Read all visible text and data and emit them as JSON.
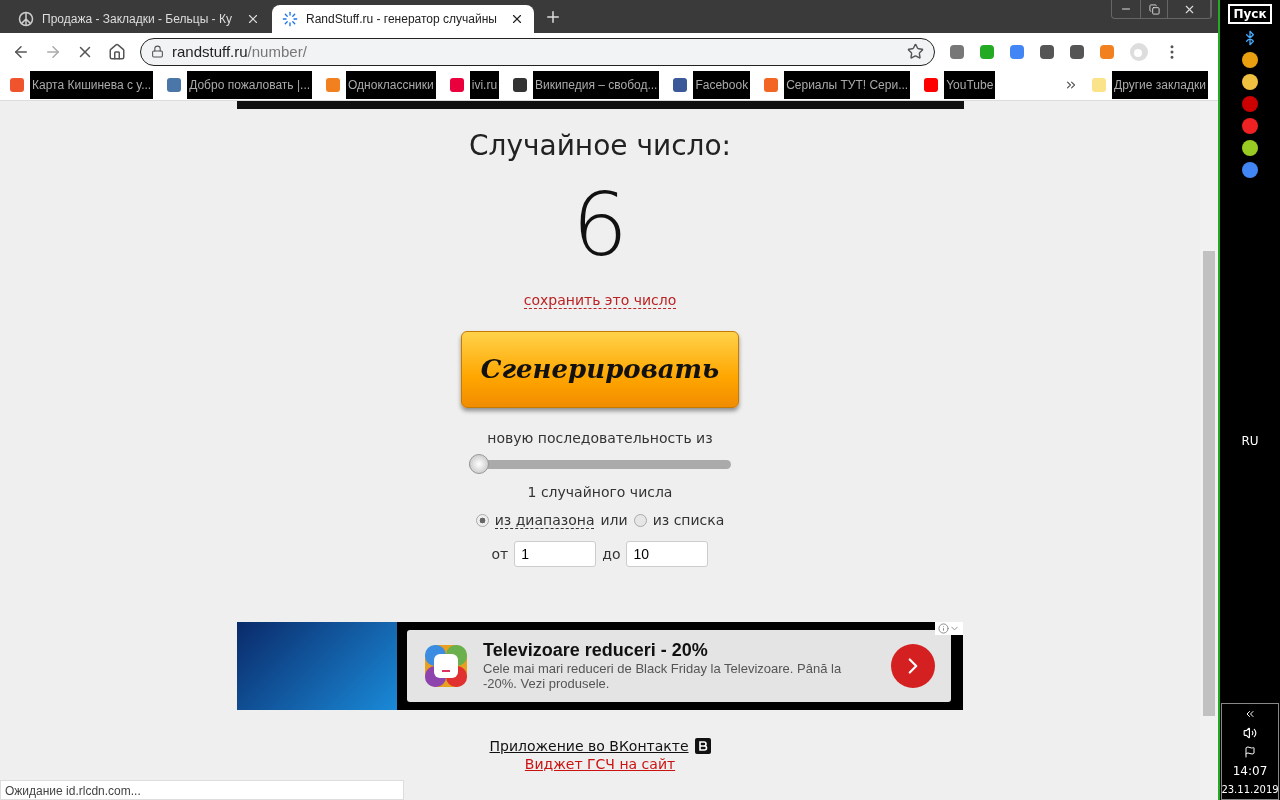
{
  "tabs": [
    {
      "title": "Продажа - Закладки - Бельцы - Ку",
      "selected": false,
      "loading": false
    },
    {
      "title": "RandStuff.ru - генератор случайны",
      "selected": true,
      "loading": true
    }
  ],
  "address": {
    "host": "randstuff.ru",
    "path": "/number/"
  },
  "bookmarks": [
    {
      "label": "Карта Кишинева с у...",
      "color": "#f0542d"
    },
    {
      "label": "Добро пожаловать |...",
      "color": "#4a76a8"
    },
    {
      "label": "Одноклассники",
      "color": "#f2801f"
    },
    {
      "label": "ivi.ru",
      "color": "#ea003d"
    },
    {
      "label": "Википедия – свобод...",
      "color": "#333333"
    },
    {
      "label": "Facebook",
      "color": "#3b5998"
    },
    {
      "label": "Сериалы ТУТ! Сери...",
      "color": "#f26522"
    },
    {
      "label": "YouTube",
      "color": "#ff0000"
    }
  ],
  "other_bookmarks": "Другие закладки",
  "page": {
    "heading": "Случайное число:",
    "number": "6",
    "save_link": "сохранить это число",
    "generate_button": "Сгенерировать",
    "sequence_label": "новую последовательность из",
    "slider": {
      "level": 0
    },
    "count_label": "1 случайного числа",
    "radios": [
      {
        "label": "из диапазона",
        "selected": true
      },
      {
        "label": "из списка",
        "selected": false
      }
    ],
    "or_word": "или",
    "from_label": "от",
    "from_value": "1",
    "to_label": "до",
    "to_value": "10"
  },
  "ad": {
    "title": "Televizoare reduceri - 20%",
    "description": "Cele mai mari reduceri de Black Friday la Televizoare. Până la -20%. Vezi produsele."
  },
  "footer_links": [
    "Приложение во ВКонтакте",
    "Виджет ГСЧ на сайт"
  ],
  "status_bar": "Ожидание id.rlcdn.com...",
  "taskbar": {
    "start": "Пуск",
    "language": "RU",
    "time": "14:07",
    "date": "23.11.2019"
  }
}
